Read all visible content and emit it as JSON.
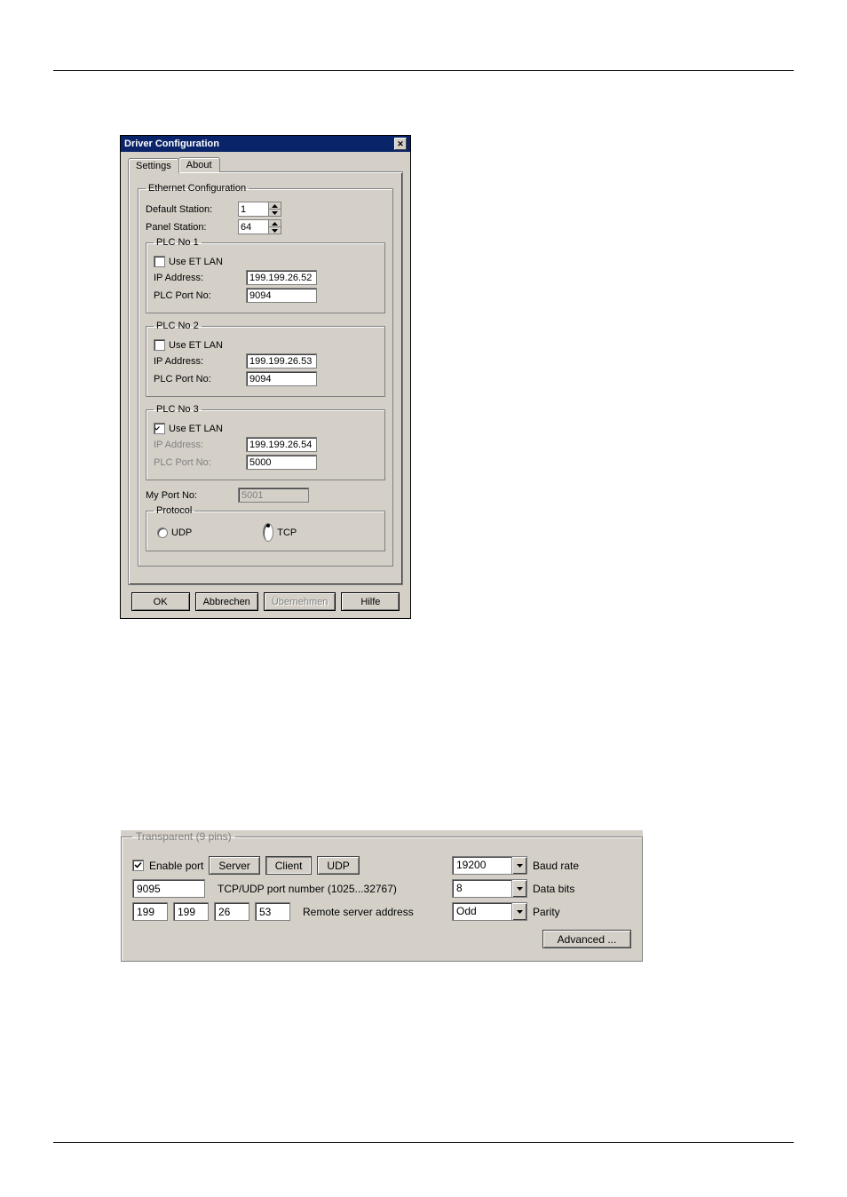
{
  "dialog": {
    "title": "Driver Configuration",
    "tabs": {
      "settings": "Settings",
      "about": "About"
    },
    "ethernet": {
      "legend": "Ethernet Configuration",
      "default_station_label": "Default Station:",
      "default_station_value": "1",
      "panel_station_label": "Panel Station:",
      "panel_station_value": "64"
    },
    "plc1": {
      "legend": "PLC No 1",
      "use_et_lan_label": "Use ET LAN",
      "use_et_lan_checked": false,
      "ip_label": "IP Address:",
      "ip_value": "199.199.26.52",
      "port_label": "PLC Port No:",
      "port_value": "9094"
    },
    "plc2": {
      "legend": "PLC No 2",
      "use_et_lan_label": "Use ET LAN",
      "use_et_lan_checked": false,
      "ip_label": "IP Address:",
      "ip_value": "199.199.26.53",
      "port_label": "PLC Port No:",
      "port_value": "9094"
    },
    "plc3": {
      "legend": "PLC No 3",
      "use_et_lan_label": "Use ET LAN",
      "use_et_lan_checked": true,
      "ip_label": "IP Address:",
      "ip_value": "199.199.26.54",
      "port_label": "PLC Port No:",
      "port_value": "5000"
    },
    "my_port_label": "My Port No:",
    "my_port_value": "5001",
    "protocol": {
      "legend": "Protocol",
      "udp_label": "UDP",
      "tcp_label": "TCP",
      "selected": "tcp"
    },
    "buttons": {
      "ok": "OK",
      "cancel": "Abbrechen",
      "apply": "Übernehmen",
      "help": "Hilfe"
    }
  },
  "transparent": {
    "legend": "Transparent (9 pins)",
    "enable_port_label": "Enable port",
    "enable_port_checked": true,
    "server_label": "Server",
    "client_label": "Client",
    "udp_label": "UDP",
    "port_value": "9095",
    "port_hint": "TCP/UDP port number (1025...32767)",
    "ip": {
      "a": "199",
      "b": "199",
      "c": "26",
      "d": "53"
    },
    "remote_label": "Remote server address",
    "baud_value": "19200",
    "baud_label": "Baud rate",
    "databits_value": "8",
    "databits_label": "Data bits",
    "parity_value": "Odd",
    "parity_label": "Parity",
    "advanced": "Advanced ..."
  }
}
